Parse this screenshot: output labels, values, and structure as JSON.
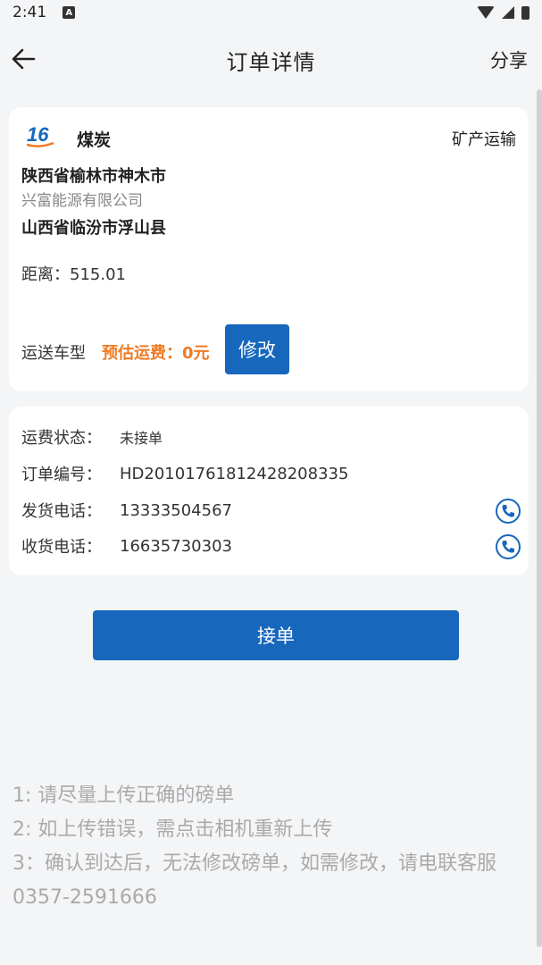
{
  "status_bar": {
    "time": "2:41",
    "notif_icon": "A"
  },
  "header": {
    "title": "订单详情",
    "share_label": "分享",
    "back_icon": "arrow-left-icon"
  },
  "cargo": {
    "logo_text": "16",
    "name": "煤炭",
    "business_type": "矿产运输",
    "from_address": "陕西省榆林市神木市",
    "company": "兴富能源有限公司",
    "to_address": "山西省临汾市浮山县",
    "distance": "距离：515.01",
    "vehicle_label": "运送车型",
    "freight_label": "预估运费：0元",
    "modify_label": "修改"
  },
  "details": {
    "status": {
      "label": "运费状态：",
      "value": "未接单"
    },
    "order_no": {
      "label": "订单编号：",
      "value": "HD20101761812428208335"
    },
    "ship_phone": {
      "label": "发货电话：",
      "value": "13333504567"
    },
    "recv_phone": {
      "label": "收货电话：",
      "value": "16635730303"
    }
  },
  "accept_label": "接单",
  "notes": [
    "1: 请尽量上传正确的磅单",
    "2: 如上传错误，需点击相机重新上传",
    "3：确认到达后，无法修改磅单，如需修改，请电联客服0357-2591666"
  ],
  "colors": {
    "primary": "#1767bd",
    "freight": "#f07a24",
    "note": "#aaaaaa"
  }
}
